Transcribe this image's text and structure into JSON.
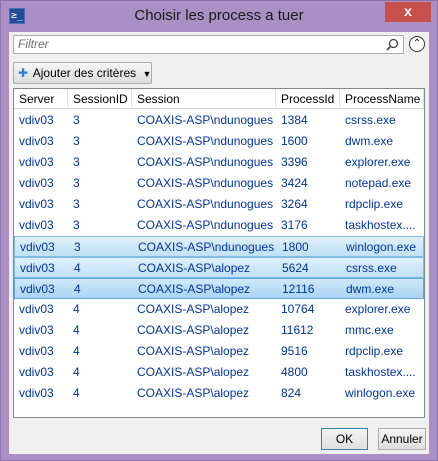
{
  "window": {
    "title": "Choisir les process a tuer",
    "app_icon_glyph": "≥_",
    "close_label": "x"
  },
  "filter": {
    "placeholder": "Filtrer",
    "search_icon": "search-icon",
    "collapse_icon": "chevron-up-circle-icon",
    "collapse_glyph": "⌃"
  },
  "criteria": {
    "plus_glyph": "✚",
    "label": "Ajouter des critères",
    "caret_glyph": "▼"
  },
  "grid": {
    "columns": [
      "Server",
      "SessionID",
      "Session",
      "ProcessId",
      "ProcessName"
    ],
    "rows": [
      {
        "server": "vdiv03",
        "session_id": "3",
        "session": "COAXIS-ASP\\ndunogues",
        "pid": "1384",
        "name": "csrss.exe",
        "selected": false
      },
      {
        "server": "vdiv03",
        "session_id": "3",
        "session": "COAXIS-ASP\\ndunogues",
        "pid": "1600",
        "name": "dwm.exe",
        "selected": false
      },
      {
        "server": "vdiv03",
        "session_id": "3",
        "session": "COAXIS-ASP\\ndunogues",
        "pid": "3396",
        "name": "explorer.exe",
        "selected": false
      },
      {
        "server": "vdiv03",
        "session_id": "3",
        "session": "COAXIS-ASP\\ndunogues",
        "pid": "3424",
        "name": "notepad.exe",
        "selected": false
      },
      {
        "server": "vdiv03",
        "session_id": "3",
        "session": "COAXIS-ASP\\ndunogues",
        "pid": "3264",
        "name": "rdpclip.exe",
        "selected": false
      },
      {
        "server": "vdiv03",
        "session_id": "3",
        "session": "COAXIS-ASP\\ndunogues",
        "pid": "3176",
        "name": "taskhostex....",
        "selected": false
      },
      {
        "server": "vdiv03",
        "session_id": "3",
        "session": "COAXIS-ASP\\ndunogues",
        "pid": "1800",
        "name": "winlogon.exe",
        "selected": true
      },
      {
        "server": "vdiv03",
        "session_id": "4",
        "session": "COAXIS-ASP\\alopez",
        "pid": "5624",
        "name": "csrss.exe",
        "selected": true
      },
      {
        "server": "vdiv03",
        "session_id": "4",
        "session": "COAXIS-ASP\\alopez",
        "pid": "12116",
        "name": "dwm.exe",
        "selected": true
      },
      {
        "server": "vdiv03",
        "session_id": "4",
        "session": "COAXIS-ASP\\alopez",
        "pid": "10764",
        "name": "explorer.exe",
        "selected": false
      },
      {
        "server": "vdiv03",
        "session_id": "4",
        "session": "COAXIS-ASP\\alopez",
        "pid": "11612",
        "name": "mmc.exe",
        "selected": false
      },
      {
        "server": "vdiv03",
        "session_id": "4",
        "session": "COAXIS-ASP\\alopez",
        "pid": "9516",
        "name": "rdpclip.exe",
        "selected": false
      },
      {
        "server": "vdiv03",
        "session_id": "4",
        "session": "COAXIS-ASP\\alopez",
        "pid": "4800",
        "name": "taskhostex....",
        "selected": false
      },
      {
        "server": "vdiv03",
        "session_id": "4",
        "session": "COAXIS-ASP\\alopez",
        "pid": "824",
        "name": "winlogon.exe",
        "selected": false
      }
    ]
  },
  "buttons": {
    "ok": "OK",
    "cancel": "Annuler"
  }
}
